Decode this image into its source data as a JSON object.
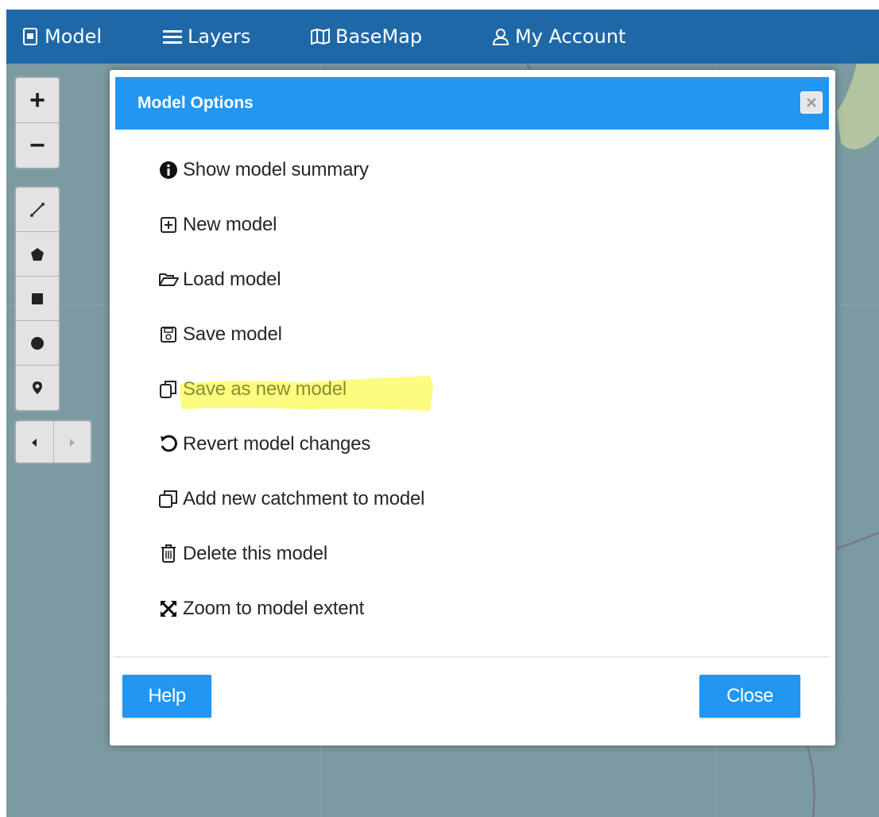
{
  "navbar": {
    "items": [
      {
        "label": "Model",
        "icon": "document-icon"
      },
      {
        "label": "Layers",
        "icon": "hamburger-icon"
      },
      {
        "label": "BaseMap",
        "icon": "map-icon"
      },
      {
        "label": "My Account",
        "icon": "user-icon"
      }
    ]
  },
  "map_controls": {
    "zoom_in": "+",
    "zoom_out": "−",
    "draw_tools": [
      "draw-polyline-icon",
      "draw-polygon-icon",
      "draw-rectangle-icon",
      "draw-circle-icon",
      "draw-marker-icon"
    ],
    "history": [
      "history-back-icon",
      "history-forward-icon"
    ]
  },
  "modal": {
    "title": "Model Options",
    "items": [
      {
        "label": "Show model summary",
        "icon": "info-icon"
      },
      {
        "label": "New model",
        "icon": "plus-square-icon"
      },
      {
        "label": "Load model",
        "icon": "folder-open-icon"
      },
      {
        "label": "Save model",
        "icon": "save-icon"
      },
      {
        "label": "Save as new model",
        "icon": "copy-icon",
        "highlighted": true
      },
      {
        "label": "Revert model changes",
        "icon": "undo-icon"
      },
      {
        "label": "Add new catchment to model",
        "icon": "clone-icon"
      },
      {
        "label": "Delete this model",
        "icon": "trash-icon"
      },
      {
        "label": "Zoom to model extent",
        "icon": "expand-icon"
      }
    ],
    "help_label": "Help",
    "close_label": "Close"
  },
  "colors": {
    "navbar": "#1f68a8",
    "modal_header": "#2196f3",
    "button": "#2196f3",
    "map_water": "#7b9aa1",
    "highlight": "#fbfb6a"
  }
}
